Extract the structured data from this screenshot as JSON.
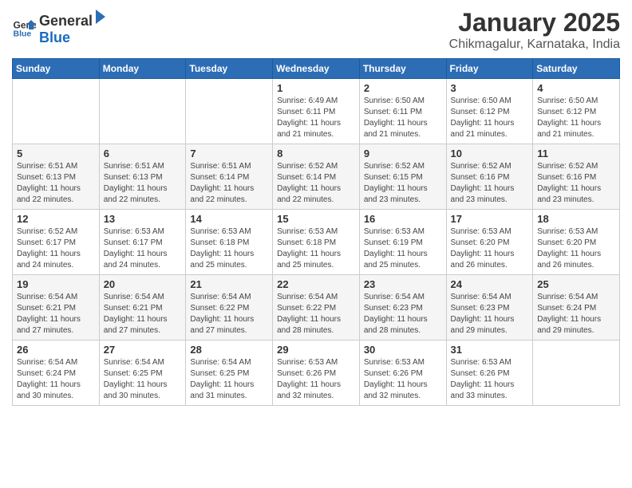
{
  "logo": {
    "general": "General",
    "blue": "Blue"
  },
  "header": {
    "month": "January 2025",
    "location": "Chikmagalur, Karnataka, India"
  },
  "weekdays": [
    "Sunday",
    "Monday",
    "Tuesday",
    "Wednesday",
    "Thursday",
    "Friday",
    "Saturday"
  ],
  "weeks": [
    [
      {
        "day": "",
        "info": ""
      },
      {
        "day": "",
        "info": ""
      },
      {
        "day": "",
        "info": ""
      },
      {
        "day": "1",
        "info": "Sunrise: 6:49 AM\nSunset: 6:11 PM\nDaylight: 11 hours\nand 21 minutes."
      },
      {
        "day": "2",
        "info": "Sunrise: 6:50 AM\nSunset: 6:11 PM\nDaylight: 11 hours\nand 21 minutes."
      },
      {
        "day": "3",
        "info": "Sunrise: 6:50 AM\nSunset: 6:12 PM\nDaylight: 11 hours\nand 21 minutes."
      },
      {
        "day": "4",
        "info": "Sunrise: 6:50 AM\nSunset: 6:12 PM\nDaylight: 11 hours\nand 21 minutes."
      }
    ],
    [
      {
        "day": "5",
        "info": "Sunrise: 6:51 AM\nSunset: 6:13 PM\nDaylight: 11 hours\nand 22 minutes."
      },
      {
        "day": "6",
        "info": "Sunrise: 6:51 AM\nSunset: 6:13 PM\nDaylight: 11 hours\nand 22 minutes."
      },
      {
        "day": "7",
        "info": "Sunrise: 6:51 AM\nSunset: 6:14 PM\nDaylight: 11 hours\nand 22 minutes."
      },
      {
        "day": "8",
        "info": "Sunrise: 6:52 AM\nSunset: 6:14 PM\nDaylight: 11 hours\nand 22 minutes."
      },
      {
        "day": "9",
        "info": "Sunrise: 6:52 AM\nSunset: 6:15 PM\nDaylight: 11 hours\nand 23 minutes."
      },
      {
        "day": "10",
        "info": "Sunrise: 6:52 AM\nSunset: 6:16 PM\nDaylight: 11 hours\nand 23 minutes."
      },
      {
        "day": "11",
        "info": "Sunrise: 6:52 AM\nSunset: 6:16 PM\nDaylight: 11 hours\nand 23 minutes."
      }
    ],
    [
      {
        "day": "12",
        "info": "Sunrise: 6:52 AM\nSunset: 6:17 PM\nDaylight: 11 hours\nand 24 minutes."
      },
      {
        "day": "13",
        "info": "Sunrise: 6:53 AM\nSunset: 6:17 PM\nDaylight: 11 hours\nand 24 minutes."
      },
      {
        "day": "14",
        "info": "Sunrise: 6:53 AM\nSunset: 6:18 PM\nDaylight: 11 hours\nand 25 minutes."
      },
      {
        "day": "15",
        "info": "Sunrise: 6:53 AM\nSunset: 6:18 PM\nDaylight: 11 hours\nand 25 minutes."
      },
      {
        "day": "16",
        "info": "Sunrise: 6:53 AM\nSunset: 6:19 PM\nDaylight: 11 hours\nand 25 minutes."
      },
      {
        "day": "17",
        "info": "Sunrise: 6:53 AM\nSunset: 6:20 PM\nDaylight: 11 hours\nand 26 minutes."
      },
      {
        "day": "18",
        "info": "Sunrise: 6:53 AM\nSunset: 6:20 PM\nDaylight: 11 hours\nand 26 minutes."
      }
    ],
    [
      {
        "day": "19",
        "info": "Sunrise: 6:54 AM\nSunset: 6:21 PM\nDaylight: 11 hours\nand 27 minutes."
      },
      {
        "day": "20",
        "info": "Sunrise: 6:54 AM\nSunset: 6:21 PM\nDaylight: 11 hours\nand 27 minutes."
      },
      {
        "day": "21",
        "info": "Sunrise: 6:54 AM\nSunset: 6:22 PM\nDaylight: 11 hours\nand 27 minutes."
      },
      {
        "day": "22",
        "info": "Sunrise: 6:54 AM\nSunset: 6:22 PM\nDaylight: 11 hours\nand 28 minutes."
      },
      {
        "day": "23",
        "info": "Sunrise: 6:54 AM\nSunset: 6:23 PM\nDaylight: 11 hours\nand 28 minutes."
      },
      {
        "day": "24",
        "info": "Sunrise: 6:54 AM\nSunset: 6:23 PM\nDaylight: 11 hours\nand 29 minutes."
      },
      {
        "day": "25",
        "info": "Sunrise: 6:54 AM\nSunset: 6:24 PM\nDaylight: 11 hours\nand 29 minutes."
      }
    ],
    [
      {
        "day": "26",
        "info": "Sunrise: 6:54 AM\nSunset: 6:24 PM\nDaylight: 11 hours\nand 30 minutes."
      },
      {
        "day": "27",
        "info": "Sunrise: 6:54 AM\nSunset: 6:25 PM\nDaylight: 11 hours\nand 30 minutes."
      },
      {
        "day": "28",
        "info": "Sunrise: 6:54 AM\nSunset: 6:25 PM\nDaylight: 11 hours\nand 31 minutes."
      },
      {
        "day": "29",
        "info": "Sunrise: 6:53 AM\nSunset: 6:26 PM\nDaylight: 11 hours\nand 32 minutes."
      },
      {
        "day": "30",
        "info": "Sunrise: 6:53 AM\nSunset: 6:26 PM\nDaylight: 11 hours\nand 32 minutes."
      },
      {
        "day": "31",
        "info": "Sunrise: 6:53 AM\nSunset: 6:26 PM\nDaylight: 11 hours\nand 33 minutes."
      },
      {
        "day": "",
        "info": ""
      }
    ]
  ]
}
